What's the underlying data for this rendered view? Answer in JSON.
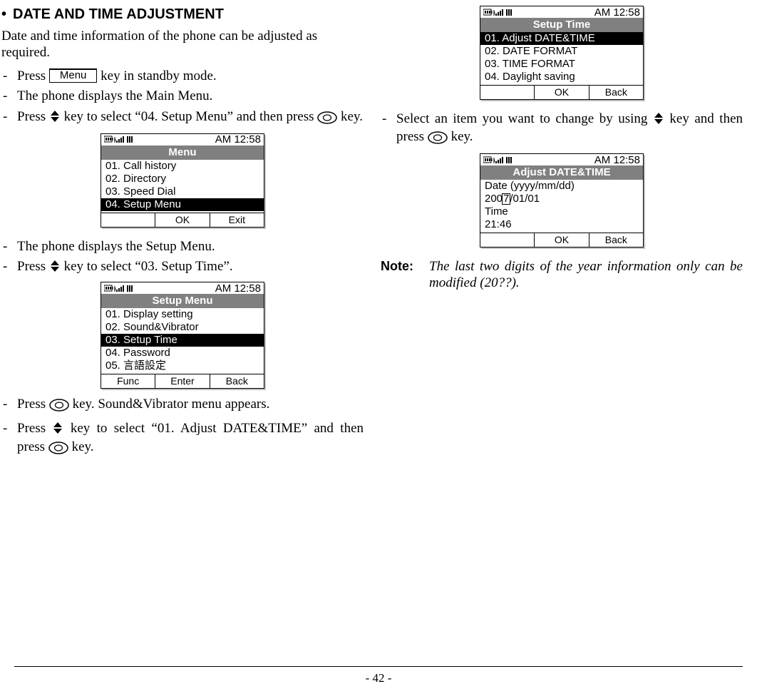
{
  "heading": "DATE AND TIME ADJUSTMENT",
  "intro": "Date and time information of the phone can be adjusted as required.",
  "menu_button_label": "Menu",
  "steps_left": {
    "s1a": "Press ",
    "s1b": " key in standby mode.",
    "s2": "The phone displays the Main Menu.",
    "s3a": "Press ",
    "s3b": " key to select “04. Setup Menu” and then press ",
    "s3c": " key.",
    "s4": "The phone displays the Setup Menu.",
    "s5a": "Press ",
    "s5b": " key to select “03. Setup Time”.",
    "s6a": "Press ",
    "s6b": " key. Sound&Vibrator menu appears.",
    "s7a": "Press ",
    "s7b": " key to select “01. Adjust DATE&TIME” and then press ",
    "s7c": " key."
  },
  "steps_right": {
    "s1a": "Select an item you want to change by using ",
    "s1b": " key and then press ",
    "s1c": " key."
  },
  "status_time": "AM 12:58",
  "softkeys": {
    "ok": "OK",
    "exit": "Exit",
    "back": "Back",
    "func": "Func",
    "enter": "Enter"
  },
  "screen_menu": {
    "title": "Menu",
    "items": [
      "01. Call history",
      "02. Directory",
      "03. Speed Dial",
      "04. Setup Menu"
    ],
    "selected": 3
  },
  "screen_setup_menu": {
    "title": "Setup Menu",
    "items": [
      "01. Display setting",
      "02. Sound&Vibrator",
      "03. Setup Time",
      "04. Password",
      "05. 言語設定"
    ],
    "selected": 2
  },
  "screen_setup_time": {
    "title": "Setup Time",
    "items": [
      "01. Adjust DATE&TIME",
      "02. DATE FORMAT",
      "03. TIME FORMAT",
      "04. Daylight saving"
    ],
    "selected": 0
  },
  "screen_adjust": {
    "title": "Adjust DATE&TIME",
    "date_label": "Date (yyyy/mm/dd)",
    "date_prefix": "200",
    "date_cursor": "7",
    "date_suffix": "/01/01",
    "time_label": "Time",
    "time_value": "21:46"
  },
  "note_label": "Note:",
  "note_body": "The last two digits of the year information only can be modified (20??).",
  "page_number": "- 42 -"
}
